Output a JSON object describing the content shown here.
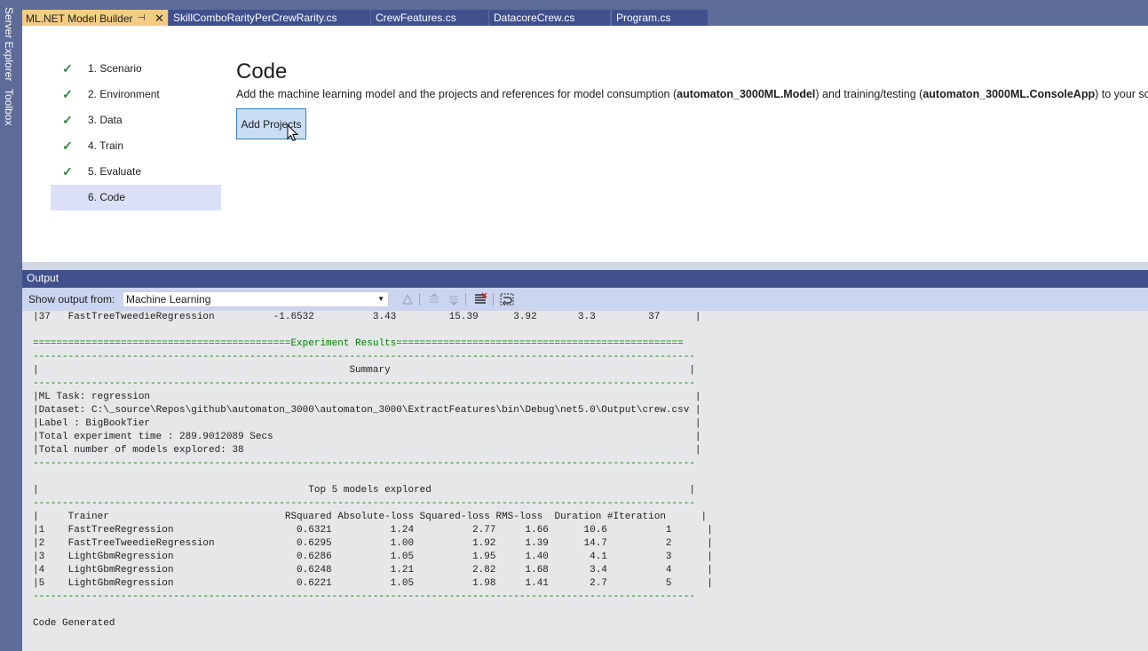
{
  "side_rail": {
    "tabs": [
      "Server Explorer",
      "Toolbox"
    ]
  },
  "tabs": [
    {
      "label": "ML.NET Model Builder",
      "active": true
    },
    {
      "label": "SkillComboRarityPerCrewRarity.cs",
      "active": false
    },
    {
      "label": "CrewFeatures.cs",
      "active": false
    },
    {
      "label": "DatacoreCrew.cs",
      "active": false
    },
    {
      "label": "Program.cs",
      "active": false
    }
  ],
  "steps": [
    {
      "label": "1. Scenario",
      "done": true
    },
    {
      "label": "2. Environment",
      "done": true
    },
    {
      "label": "3. Data",
      "done": true
    },
    {
      "label": "4. Train",
      "done": true
    },
    {
      "label": "5. Evaluate",
      "done": true
    },
    {
      "label": "6. Code",
      "done": false
    }
  ],
  "code_page": {
    "title": "Code",
    "desc_part1": "Add the machine learning model and the projects and references for model consumption (",
    "model_project": "automaton_3000ML.Model",
    "desc_part2": ") and training/testing (",
    "console_project": "automaton_3000ML.ConsoleApp",
    "desc_part3": ") to your solution.",
    "add_button": "Add Projects"
  },
  "output": {
    "title": "Output",
    "show_from_label": "Show output from:",
    "source": "Machine Learning",
    "lines": [
      {
        "text": "|37   FastTreeTweedieRegression          -1.6532          3.43         15.39      3.92       3.3         37      |",
        "green": false
      },
      {
        "text": "",
        "green": false
      },
      {
        "text": "============================================Experiment Results=================================================",
        "green": true
      },
      {
        "text": "-----------------------------------------------------------------------------------------------------------------",
        "green": true
      },
      {
        "text": "|                                                     Summary                                                   |",
        "green": false
      },
      {
        "text": "-----------------------------------------------------------------------------------------------------------------",
        "green": true
      },
      {
        "text": "|ML Task: regression                                                                                             |",
        "green": false
      },
      {
        "text": "|Dataset: C:\\_source\\Repos\\github\\automaton_3000\\automaton_3000\\ExtractFeatures\\bin\\Debug\\net5.0\\Output\\crew.csv |",
        "green": false
      },
      {
        "text": "|Label : BigBookTier                                                                                             |",
        "green": false
      },
      {
        "text": "|Total experiment time : 289.9012089 Secs                                                                        |",
        "green": false
      },
      {
        "text": "|Total number of models explored: 38                                                                             |",
        "green": false
      },
      {
        "text": "-----------------------------------------------------------------------------------------------------------------",
        "green": true
      },
      {
        "text": "",
        "green": false
      },
      {
        "text": "|                                              Top 5 models explored                                            |",
        "green": false
      },
      {
        "text": "-----------------------------------------------------------------------------------------------------------------",
        "green": true
      },
      {
        "text": "|     Trainer                              RSquared Absolute-loss Squared-loss RMS-loss  Duration #Iteration      |",
        "green": false
      },
      {
        "text": "|1    FastTreeRegression                     0.6321          1.24          2.77     1.66      10.6          1      |",
        "green": false
      },
      {
        "text": "|2    FastTreeTweedieRegression              0.6295          1.00          1.92     1.39      14.7          2      |",
        "green": false
      },
      {
        "text": "|3    LightGbmRegression                     0.6286          1.05          1.95     1.40       4.1          3      |",
        "green": false
      },
      {
        "text": "|4    LightGbmRegression                     0.6248          1.21          2.82     1.68       3.4          4      |",
        "green": false
      },
      {
        "text": "|5    LightGbmRegression                     0.6221          1.05          1.98     1.41       2.7          5      |",
        "green": false
      },
      {
        "text": "-----------------------------------------------------------------------------------------------------------------",
        "green": true
      },
      {
        "text": "",
        "green": false
      },
      {
        "text": "Code Generated",
        "green": false
      }
    ]
  },
  "colors": {
    "chrome": "#5d6b99",
    "tab_inactive": "#40508d",
    "tab_active": "#f5cc84",
    "selected_step": "#dce0f6",
    "check": "#28873a",
    "console_green": "#008000"
  }
}
